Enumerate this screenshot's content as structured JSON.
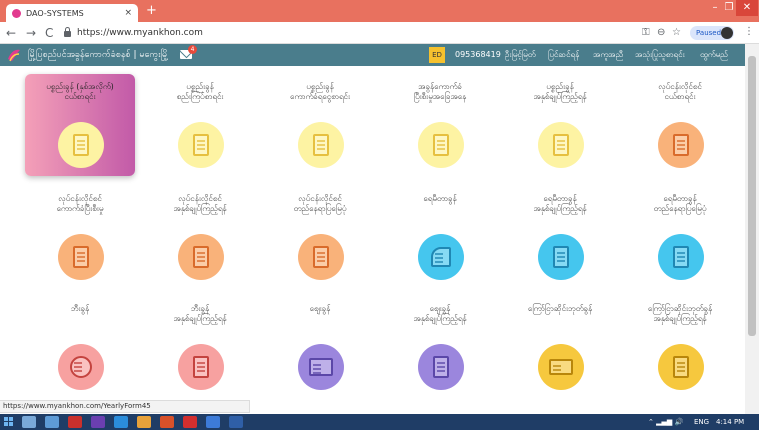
{
  "browser": {
    "tab_title": "DAO-SYSTEMS",
    "tab_close": "×",
    "new_tab": "+",
    "win_min": "–",
    "win_max": "❐",
    "win_close": "✕",
    "nav_back": "←",
    "nav_forward": "→",
    "nav_reload": "C",
    "url": "https://www.myankhon.com",
    "key_glyph": "⚿",
    "zoom_glyph": "⊖",
    "star_glyph": "☆",
    "profile_label": "Paused",
    "menu_glyph": "⋮"
  },
  "site": {
    "title": "မြို့ပြစည်ပင်အခွန်ကောက်ခံစနစ် | မကွေးမြို့",
    "mail_badge": "4",
    "user_chip": "ED",
    "phone": "095368419",
    "links": [
      "ဦးမြင့်မြတ်",
      "ပြင်ဆင်ရန်",
      "အကူအညီ",
      "အသုံးပြုသူစာရင်း",
      "ထွက်မည်"
    ]
  },
  "cards": [
    {
      "label": "ပစ္စည်းခွန် (နှစ်အလိုက်)\nငယ်စာရင်း",
      "icon": "document-list-icon",
      "active": true,
      "bg": "#fdf3a3",
      "fg": "#e6c040"
    },
    {
      "label": "ပစ္စည်းခွန်\nစည်းကြပ်စာရင်း",
      "icon": "document-stamp-icon",
      "active": false,
      "bg": "#fdf3a3",
      "fg": "#e6c040"
    },
    {
      "label": "ပစ္စည်းခွန်\nကောက်ခံရငွေစာရင်း",
      "icon": "money-hand-icon",
      "active": false,
      "bg": "#fdf3a3",
      "fg": "#e6c040"
    },
    {
      "label": "အခွန်ကောက်ခံ\nပြီးစီးမှုအခြေအနေ",
      "icon": "calendar-document-icon",
      "active": false,
      "bg": "#fdf3a3",
      "fg": "#e6c040"
    },
    {
      "label": "ပစ္စည်းခွန်\nအနှစ်ချုပ်ကြည့်ရန်",
      "icon": "report-chart-icon",
      "active": false,
      "bg": "#fdf3a3",
      "fg": "#e6c040"
    },
    {
      "label": "လုပ်ငန်းလိုင်စင်\nငယ်စာရင်း",
      "icon": "license-search-icon",
      "active": false,
      "bg": "#f9b27a",
      "fg": "#d96b2b"
    },
    {
      "label": "လုပ်ငန်းလိုင်စင်\nကောက်ခံပြီးစီးမှု",
      "icon": "calendar-search-icon",
      "active": false,
      "bg": "#f9b27a",
      "fg": "#d96b2b"
    },
    {
      "label": "လုပ်ငန်းလိုင်စင်\nအနှစ်ချုပ်ကြည့်ရန်",
      "icon": "bar-chart-document-icon",
      "active": false,
      "bg": "#f9b27a",
      "fg": "#d96b2b"
    },
    {
      "label": "လုပ်ငန်းလိုင်စင်\nတည်နေရာပြမြေပုံ",
      "icon": "location-document-icon",
      "active": false,
      "bg": "#f9b27a",
      "fg": "#d96b2b"
    },
    {
      "label": "ရေမီတာခွန်",
      "icon": "water-tap-icon",
      "active": false,
      "bg": "#45c6ee",
      "fg": "#1f87b3"
    },
    {
      "label": "ရေမီတာခွန်\nအနှစ်ချုပ်ကြည့်ရန်",
      "icon": "report-chart-icon",
      "active": false,
      "bg": "#45c6ee",
      "fg": "#1f87b3"
    },
    {
      "label": "ရေမီတာခွန်\nတည်နေရာပြမြေပုံ",
      "icon": "location-document-icon",
      "active": false,
      "bg": "#45c6ee",
      "fg": "#1f87b3"
    },
    {
      "label": "ဘီးခွန်",
      "icon": "wheel-icon",
      "active": false,
      "bg": "#f7a1a0",
      "fg": "#c4433f"
    },
    {
      "label": "ဘီးခွန်\nအနှစ်ချုပ်ကြည့်ရန်",
      "icon": "bar-chart-document-icon",
      "active": false,
      "bg": "#f7a1a0",
      "fg": "#c4433f"
    },
    {
      "label": "ဈေးခွန်",
      "icon": "market-stall-icon",
      "active": false,
      "bg": "#9b86dd",
      "fg": "#5b47a8"
    },
    {
      "label": "ဈေးခွန်\nအနှစ်ချုပ်ကြည့်ရန်",
      "icon": "bar-chart-document-icon",
      "active": false,
      "bg": "#9b86dd",
      "fg": "#5b47a8"
    },
    {
      "label": "ကြော်ငြာဆိုင်းဘုတ်ခွန်",
      "icon": "ad-board-icon",
      "active": false,
      "bg": "#f6c83e",
      "fg": "#b8860b"
    },
    {
      "label": "ကြော်ငြာဆိုင်းဘုတ်ခွန်\nအနှစ်ချုပ်ကြည့်ရန်",
      "icon": "ad-chart-document-icon",
      "active": false,
      "bg": "#f6c83e",
      "fg": "#b8860b"
    }
  ],
  "status_bar": "https://www.myankhon.com/YearlyForm45",
  "taskbar": {
    "tray_icons": "⌃  ▂▄▆  🔊",
    "lang": "ENG",
    "clock": "4:14 PM",
    "apps": [
      "#7aa9d8",
      "#5e9bd6",
      "#c9302c",
      "#6a3fb0",
      "#2b8ddb",
      "#e8a23a",
      "#d8512a",
      "#d32f2f",
      "#3d7bd8",
      "#2f5fa7"
    ]
  }
}
